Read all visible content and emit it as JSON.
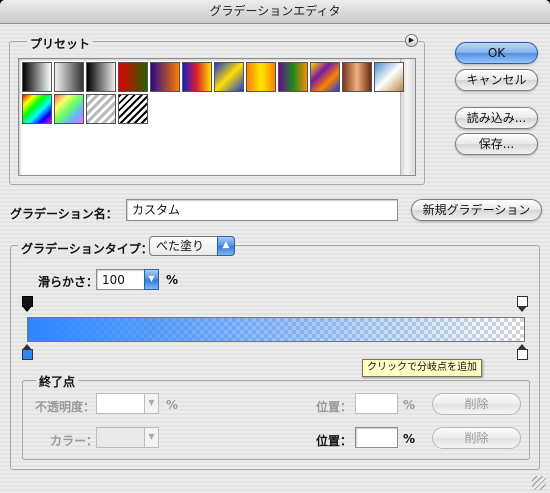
{
  "window": {
    "title": "グラデーションエディタ"
  },
  "presets": {
    "label": "プリセット",
    "swatches": [
      {
        "name": "black-white",
        "css": "linear-gradient(90deg,#000,#fff)"
      },
      {
        "name": "transparent-black",
        "css": "linear-gradient(90deg,rgba(0,0,0,0.05),#333)"
      },
      {
        "name": "black-transparent",
        "css": "linear-gradient(90deg,#000,#eee)"
      },
      {
        "name": "red-green",
        "css": "linear-gradient(90deg,#e00000,#2a5f00)"
      },
      {
        "name": "violet-orange",
        "css": "linear-gradient(90deg,#2a0a8a,#ff7a00)"
      },
      {
        "name": "blue-red-yellow",
        "css": "linear-gradient(90deg,#1a1acc,#e0202a,#ffe000)"
      },
      {
        "name": "blue-yellow-blue",
        "css": "linear-gradient(135deg,#1a3ad0,#ffe000 50%,#1a3ad0)"
      },
      {
        "name": "orange-yellow-orange",
        "css": "linear-gradient(90deg,#ff8000,#ffe800 50%,#ff8000)"
      },
      {
        "name": "violet-green-orange",
        "css": "linear-gradient(90deg,#6a0a8a,#1a8a20 50%,#ff8a00)"
      },
      {
        "name": "yellow-violet-orange-blue",
        "css": "linear-gradient(135deg,#ffd000,#7a1aa0 35%,#ff8000 65%,#1a40d0)"
      },
      {
        "name": "copper",
        "css": "linear-gradient(90deg,#7a3a1a,#f0b080 50%,#6a2a10)"
      },
      {
        "name": "chrome",
        "css": "linear-gradient(135deg,#4a90d0,#ffffff 50%,#b08a40)"
      },
      {
        "name": "spectrum",
        "css": "linear-gradient(135deg,#ff0000,#ffff00,#00ff00,#00ffff,#0000ff,#ff00ff)"
      },
      {
        "name": "transparent-rainbow",
        "css": "linear-gradient(135deg,rgba(255,0,0,0.6),rgba(255,255,0,0.6),rgba(0,255,0,0.6),rgba(0,128,255,0.6),rgba(255,0,255,0.6))"
      },
      {
        "name": "transparent-stripes",
        "css": "repeating-linear-gradient(135deg,#bbb 0 3px,#fff 3px 6px)"
      },
      {
        "name": "black-stripes",
        "css": "repeating-linear-gradient(135deg,#000 0 2px,#fff 2px 5px)"
      }
    ]
  },
  "buttons": {
    "ok": "OK",
    "cancel": "キャンセル",
    "load": "読み込み...",
    "save": "保存...",
    "new_gradient": "新規グラデーション"
  },
  "name": {
    "label": "グラデーション名：",
    "value": "カスタム"
  },
  "type": {
    "label": "グラデーションタイプ：",
    "value": "べた塗り"
  },
  "smoothness": {
    "label": "滑らかさ：",
    "value": "100",
    "unit": "%"
  },
  "gradient": {
    "color": "#2e86ff",
    "opacity_stops": [
      {
        "location": 0
      },
      {
        "location": 100
      }
    ],
    "color_stops": [
      {
        "location": 0,
        "color": "#2e86ff"
      },
      {
        "location": 100,
        "color": "#ffffff"
      }
    ]
  },
  "tooltip": "クリックで分岐点を追加",
  "stops": {
    "label": "終了点",
    "opacity_label": "不透明度：",
    "opacity_unit": "%",
    "color_label": "カラー：",
    "location_label_1": "位置：",
    "location_unit_1": "%",
    "location_label_2": "位置：",
    "location_unit_2": "%",
    "delete_1": "削除",
    "delete_2": "削除"
  }
}
